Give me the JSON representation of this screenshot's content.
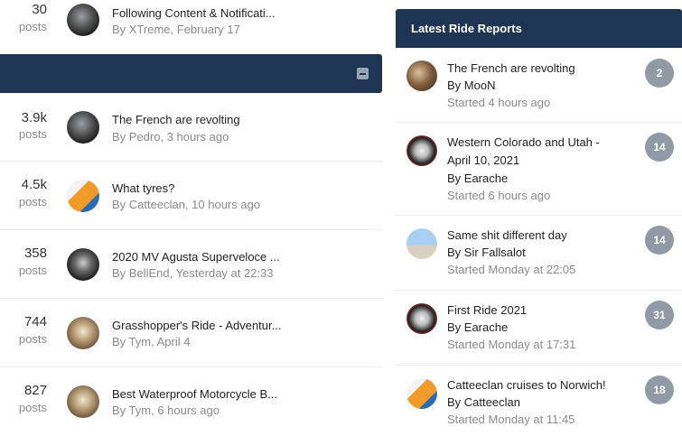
{
  "forum": {
    "rows": [
      {
        "count": "30",
        "label": "posts",
        "title": "Following Content & Notificati...",
        "meta": "By XTreme, February 17"
      },
      {
        "count": "3.9k",
        "label": "posts",
        "title": "The French are revolting",
        "meta": "By Pedro, 3 hours ago"
      },
      {
        "count": "4.5k",
        "label": "posts",
        "title": "What tyres?",
        "meta": "By Catteeclan, 10 hours ago"
      },
      {
        "count": "358",
        "label": "posts",
        "title": "2020 MV Agusta Superveloce ...",
        "meta": "By BellEnd, Yesterday at 22:33"
      },
      {
        "count": "744",
        "label": "posts",
        "title": "Grasshopper's Ride - Adventur...",
        "meta": "By Tym, April 4"
      },
      {
        "count": "827",
        "label": "posts",
        "title": "Best Waterproof Motorcycle B...",
        "meta": "By Tym, 6 hours ago"
      }
    ]
  },
  "reports": {
    "heading": "Latest Ride Reports",
    "items": [
      {
        "title": "The French are revolting",
        "by": "By MooN",
        "started": "Started 4 hours ago",
        "count": "2"
      },
      {
        "title": "Western Colorado and Utah - April 10, 2021",
        "by": "By Earache",
        "started": "Started 6 hours ago",
        "count": "14"
      },
      {
        "title": "Same shit different day",
        "by": "By Sir Fallsalot",
        "started": "Started Monday at 22:05",
        "count": "14"
      },
      {
        "title": "First Ride 2021",
        "by": "By Earache",
        "started": "Started Monday at 17:31",
        "count": "31"
      },
      {
        "title": "Catteeclan cruises to Norwich!",
        "by": "By Catteeclan",
        "started": "Started Monday at 11:45",
        "count": "18"
      }
    ]
  }
}
